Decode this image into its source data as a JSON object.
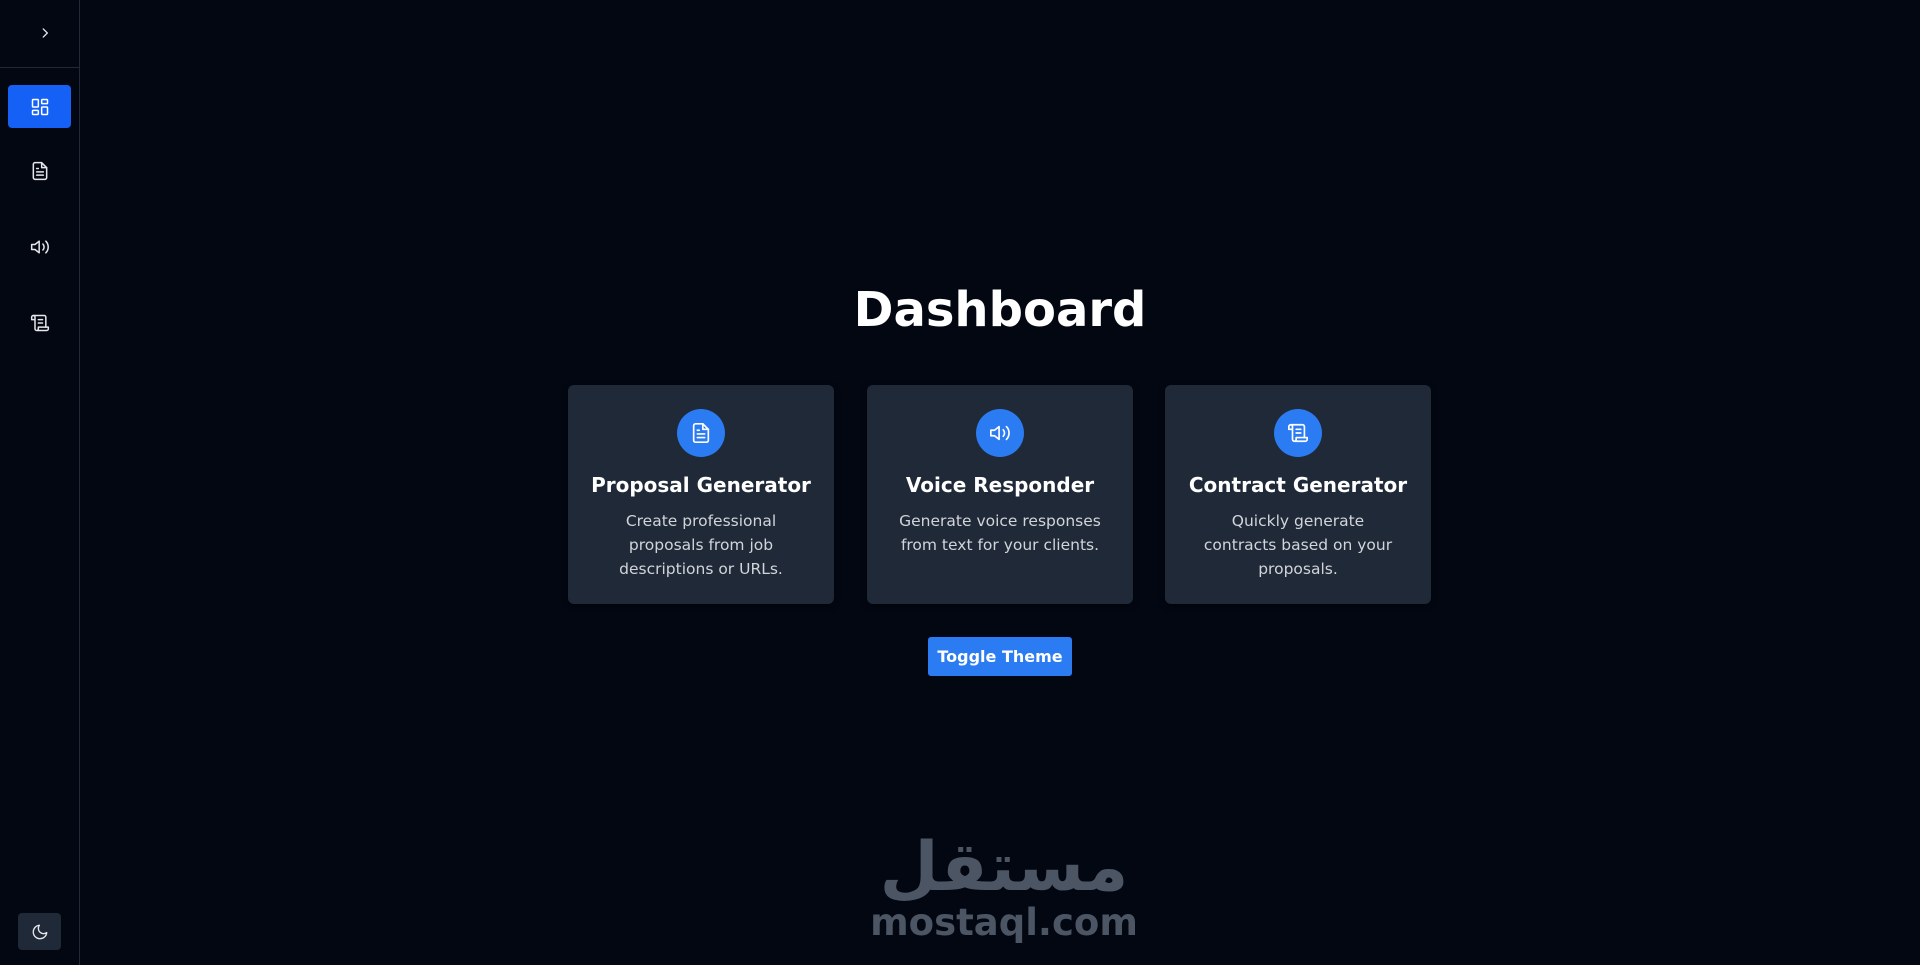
{
  "sidebar": {
    "expand_icon": "chevron-right-icon",
    "items": [
      {
        "name": "dashboard",
        "icon": "grid-icon",
        "active": true
      },
      {
        "name": "proposal-generator",
        "icon": "file-text-icon",
        "active": false
      },
      {
        "name": "voice-responder",
        "icon": "speaker-icon",
        "active": false
      },
      {
        "name": "contract-generator",
        "icon": "scroll-icon",
        "active": false
      }
    ],
    "theme_icon": "moon-icon"
  },
  "main": {
    "title": "Dashboard",
    "cards": [
      {
        "title": "Proposal Generator",
        "description": "Create professional proposals from job descriptions or URLs.",
        "icon": "file-text-icon"
      },
      {
        "title": "Voice Responder",
        "description": "Generate voice responses from text for your clients.",
        "icon": "speaker-icon"
      },
      {
        "title": "Contract Generator",
        "description": "Quickly generate contracts based on your proposals.",
        "icon": "scroll-icon"
      }
    ],
    "toggle_label": "Toggle Theme"
  },
  "watermark": {
    "arabic": "مستقل",
    "latin": "mostaql.com"
  },
  "colors": {
    "background": "#030712",
    "accent": "#2b7cf2",
    "active_nav": "#1560f5",
    "card": "#1f2937"
  }
}
